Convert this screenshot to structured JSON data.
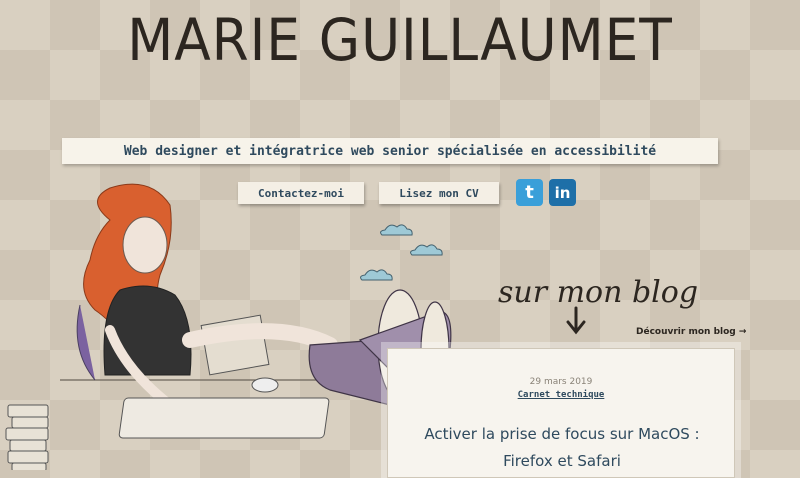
{
  "header": {
    "site_title": "MARIE GUILLAUMET",
    "tagline": "Web designer et intégratrice web senior spécialisée en accessibilité"
  },
  "actions": {
    "contact_label": "Contactez-moi",
    "cv_label": "Lisez mon CV"
  },
  "social": {
    "twitter_icon": "twitter-icon",
    "twitter_glyph": "t",
    "linkedin_icon": "linkedin-icon",
    "linkedin_glyph": "in"
  },
  "blog": {
    "heading": "sur mon blog",
    "discover_link": "Découvrir mon blog →",
    "latest_post": {
      "date": "29 mars 2019",
      "category": "Carnet technique",
      "title": "Activer la prise de focus sur MacOS : Firefox et Safari"
    }
  },
  "colors": {
    "background": "#d9d0c1",
    "title": "#2c2620",
    "accent": "#2f4a5e",
    "paper": "#f7f3ea"
  }
}
